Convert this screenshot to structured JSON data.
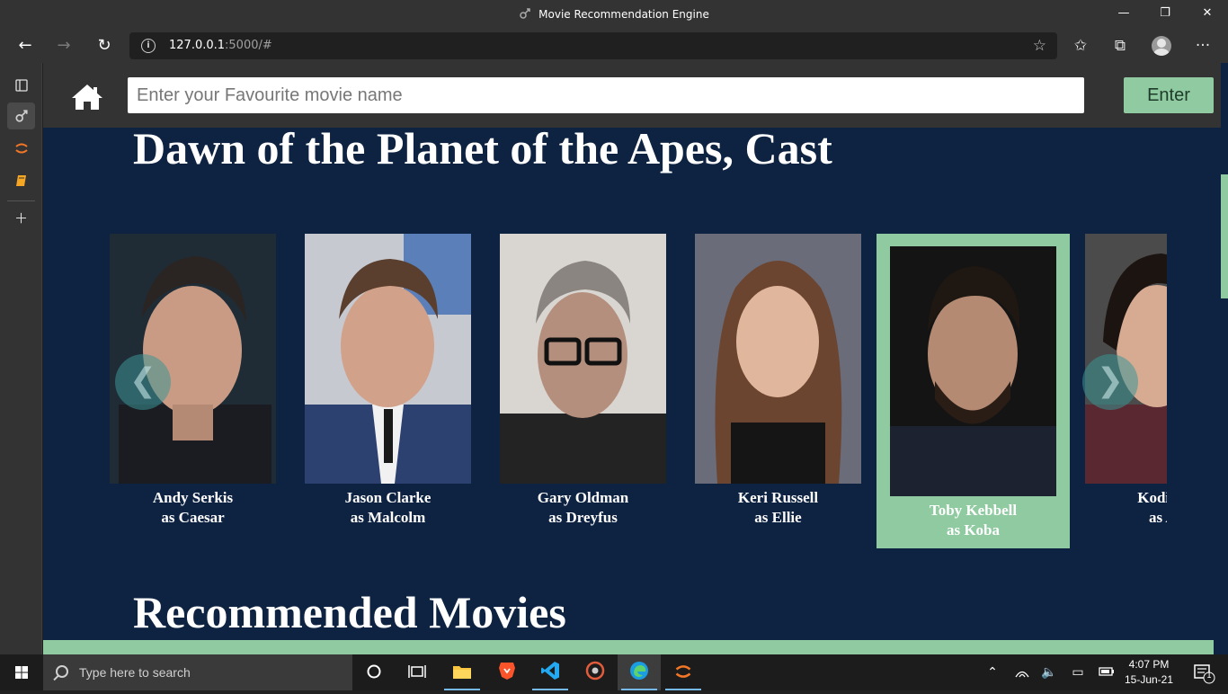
{
  "window": {
    "title": "Movie Recommendation Engine",
    "minimize": "—",
    "restore": "❐",
    "close": "✕"
  },
  "browser": {
    "url_host": "127.0.0.1",
    "url_rest": ":5000/#",
    "back": "←",
    "forward": "→",
    "refresh": "↻",
    "more": "···"
  },
  "app": {
    "search_placeholder": "Enter your Favourite movie name",
    "enter_label": "Enter",
    "cast_heading": "Dawn of the Planet of the Apes, Cast",
    "recommended_heading": "Recommended Movies"
  },
  "cast": [
    {
      "name": "Andy Serkis",
      "role": "as Caesar"
    },
    {
      "name": "Jason Clarke",
      "role": "as Malcolm"
    },
    {
      "name": "Gary Oldman",
      "role": "as Dreyfus"
    },
    {
      "name": "Keri Russell",
      "role": "as Ellie"
    },
    {
      "name": "Toby Kebbell",
      "role": "as Koba"
    },
    {
      "name": "Kodi Smi",
      "role": "as Ale"
    }
  ],
  "colors": {
    "page_bg": "#0e2342",
    "accent": "#8fcaa0",
    "header_bg": "#333333"
  },
  "taskbar": {
    "search_text": "Type here to search",
    "time": "4:07 PM",
    "date": "15-Jun-21",
    "notification_count": "1"
  }
}
